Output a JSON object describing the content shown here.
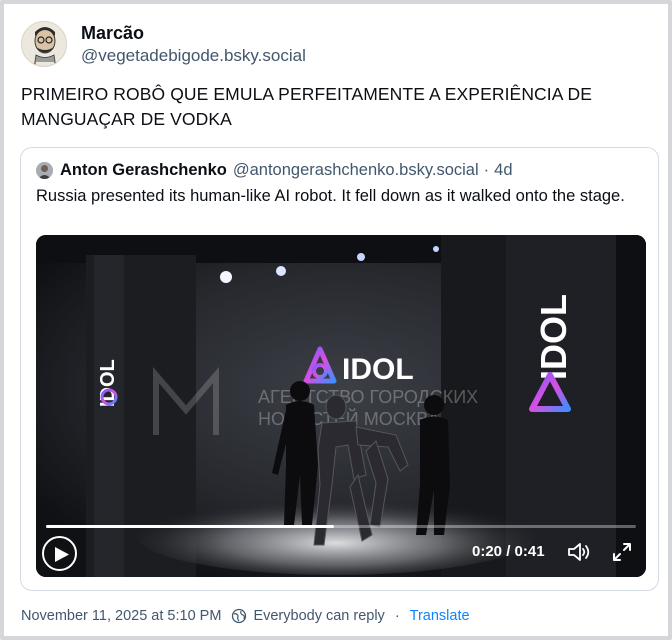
{
  "post": {
    "author_name": "Marcão",
    "author_handle": "@vegetadebigode.bsky.social",
    "text": "PRIMEIRO ROBÔ QUE EMULA PERFEITAMENTE A EXPERIÊNCIA DE MANGUAÇAR DE VODKA",
    "footer": {
      "date": "November 11, 2025 at 5:10 PM",
      "reply_setting": "Everybody can reply",
      "separator": "·",
      "translate_label": "Translate"
    }
  },
  "quote": {
    "author_name": "Anton Gerashchenko",
    "author_handle": "@antongerashchenko.bsky.social",
    "dot": "·",
    "time": "4d",
    "text": "Russia presented its human-like AI robot. It fell down as it walked onto the stage.",
    "video": {
      "current_time": "0:20",
      "time_separator": " / ",
      "duration": "0:41",
      "progress_fraction": 0.488,
      "stage_logo_text": "IDOL",
      "watermark_line1": "АГЕНТСТВО ГОРОДСКИХ",
      "watermark_line2": "НОВОСТЕЙ МОСКВА"
    }
  },
  "colors": {
    "link": "#1083fe",
    "muted_text": "#42576c",
    "border": "#d4dbe2"
  },
  "icons": {
    "play": "play-icon",
    "volume": "volume-icon",
    "fullscreen": "fullscreen-icon",
    "globe": "globe-icon"
  }
}
